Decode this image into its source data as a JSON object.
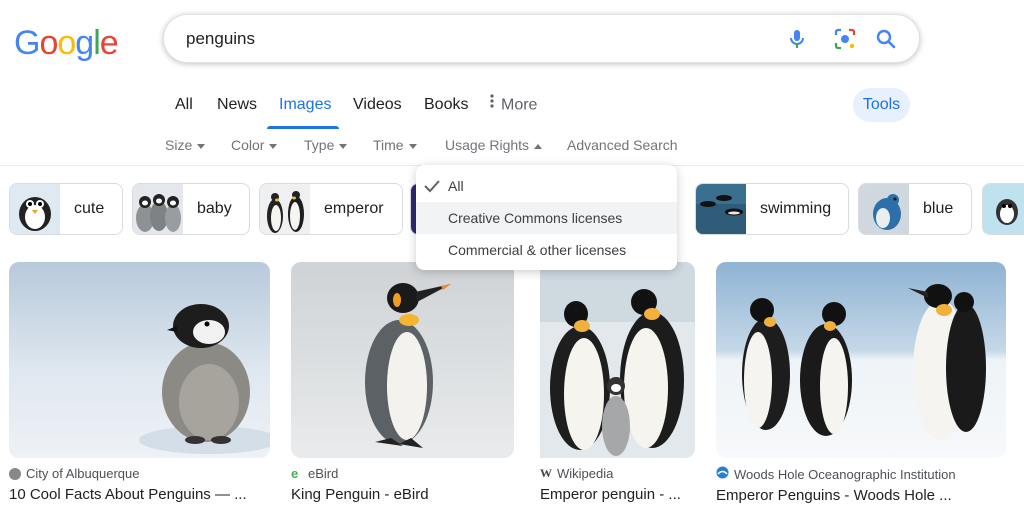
{
  "search": {
    "query": "penguins"
  },
  "tabs": [
    {
      "label": "All"
    },
    {
      "label": "News"
    },
    {
      "label": "Images"
    },
    {
      "label": "Videos"
    },
    {
      "label": "Books"
    },
    {
      "label": "More"
    }
  ],
  "tools_label": "Tools",
  "filters": {
    "size": "Size",
    "color": "Color",
    "type": "Type",
    "time": "Time",
    "usage_rights": "Usage Rights",
    "advanced": "Advanced Search"
  },
  "chips": [
    {
      "label": "cute"
    },
    {
      "label": "baby"
    },
    {
      "label": "emperor"
    },
    {
      "label": "swimming"
    },
    {
      "label": "blue"
    }
  ],
  "usage_dropdown": {
    "items": [
      {
        "label": "All",
        "selected": true
      },
      {
        "label": "Creative Commons licenses",
        "selected": false
      },
      {
        "label": "Commercial & other licenses",
        "selected": false
      }
    ]
  },
  "results": [
    {
      "source": "City of Albuquerque",
      "title": "10 Cool Facts About Penguins — ..."
    },
    {
      "source": "eBird",
      "title": "King Penguin - eBird"
    },
    {
      "source": "Wikipedia",
      "source_mark": "W",
      "title": "Emperor penguin - ..."
    },
    {
      "source": "Woods Hole Oceanographic Institution",
      "title": "Emperor Penguins - Woods Hole ..."
    }
  ],
  "colors": {
    "accent": "#1a73e8",
    "logo_blue": "#4285f4",
    "logo_red": "#ea4335",
    "logo_yellow": "#fbbc05",
    "logo_green": "#34a853"
  }
}
